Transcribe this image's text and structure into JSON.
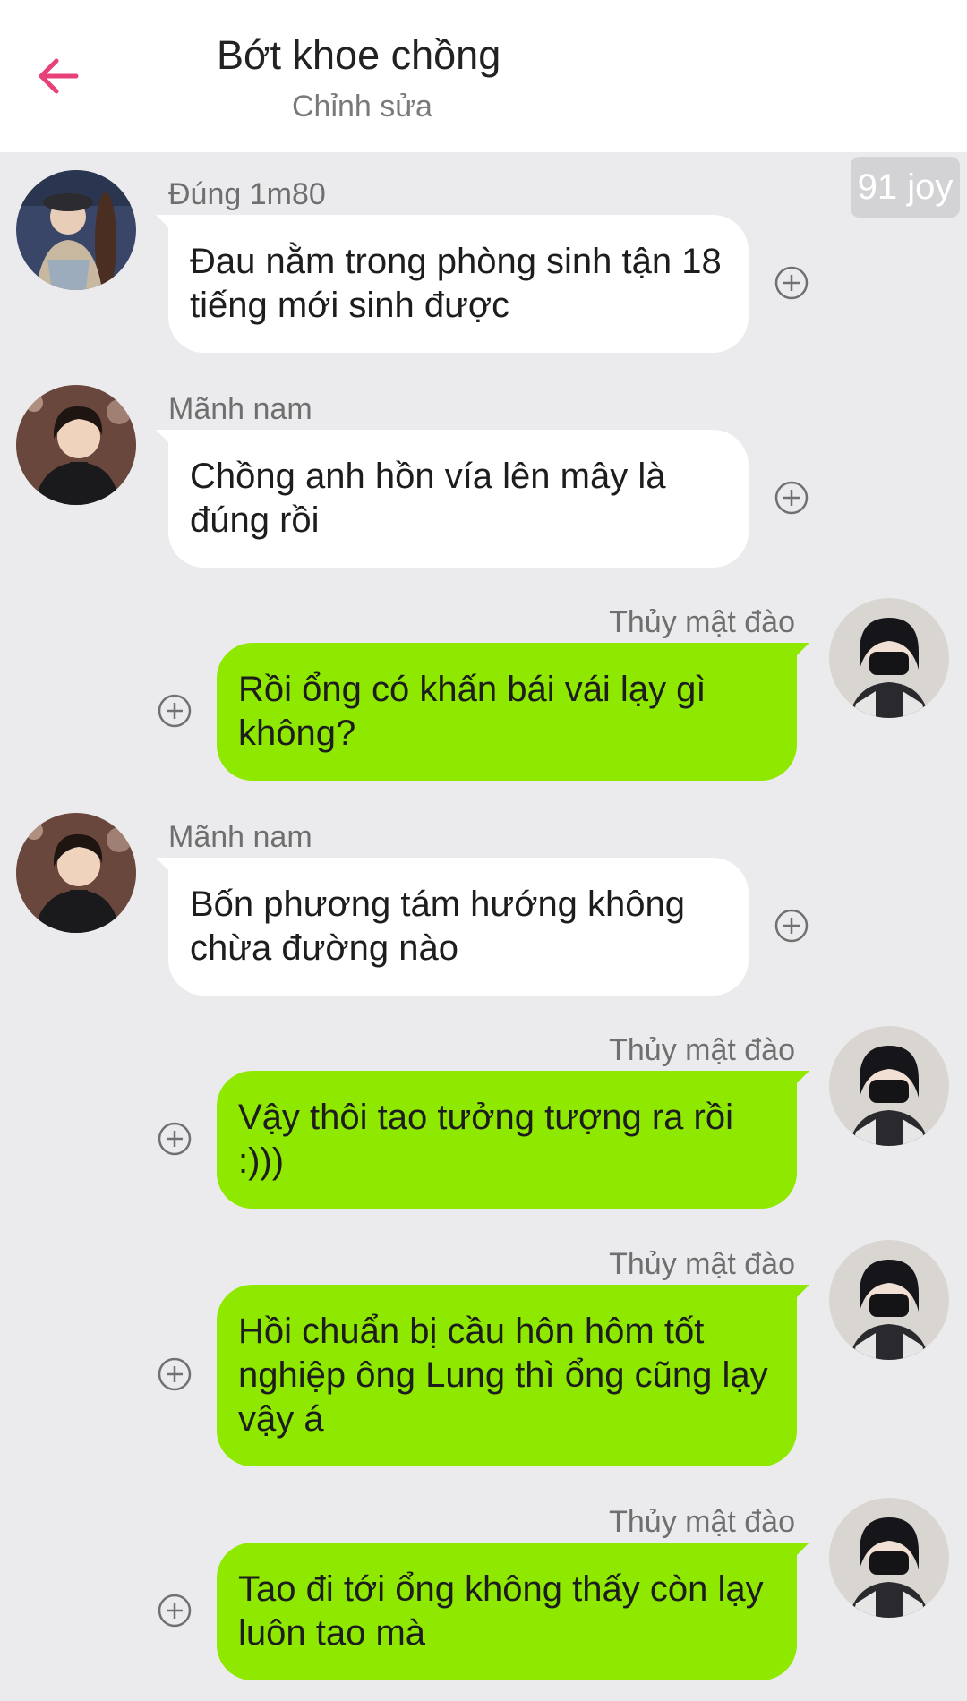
{
  "header": {
    "title": "Bớt khoe chồng",
    "subtitle": "Chỉnh sửa"
  },
  "badge": "91 joy",
  "colors": {
    "accent": "#e8407a",
    "incoming_bubble": "#ffffff",
    "outgoing_bubble": "#8ee800",
    "background": "#ebebed"
  },
  "messages": [
    {
      "side": "left",
      "sender": "Đúng 1m80",
      "text": "Đau nằm trong phòng sinh tận 18 tiếng mới sinh được"
    },
    {
      "side": "left",
      "sender": "Mãnh nam",
      "text": "Chồng anh hồn vía lên mây là đúng rồi"
    },
    {
      "side": "right",
      "sender": "Thủy mật đào",
      "text": "Rồi ổng có khấn bái vái lạy gì không?"
    },
    {
      "side": "left",
      "sender": "Mãnh nam",
      "text": "Bốn phương tám hướng không chừa đường nào"
    },
    {
      "side": "right",
      "sender": "Thủy mật đào",
      "text": "Vậy thôi tao tưởng tượng ra rồi :)))"
    },
    {
      "side": "right",
      "sender": "Thủy mật đào",
      "text": "Hồi chuẩn bị cầu hôn hôm tốt nghiệp ông Lung thì ổng cũng lạy vậy á"
    },
    {
      "side": "right",
      "sender": "Thủy mật đào",
      "text": "Tao đi tới ổng không thấy còn lạy luôn tao mà"
    }
  ]
}
